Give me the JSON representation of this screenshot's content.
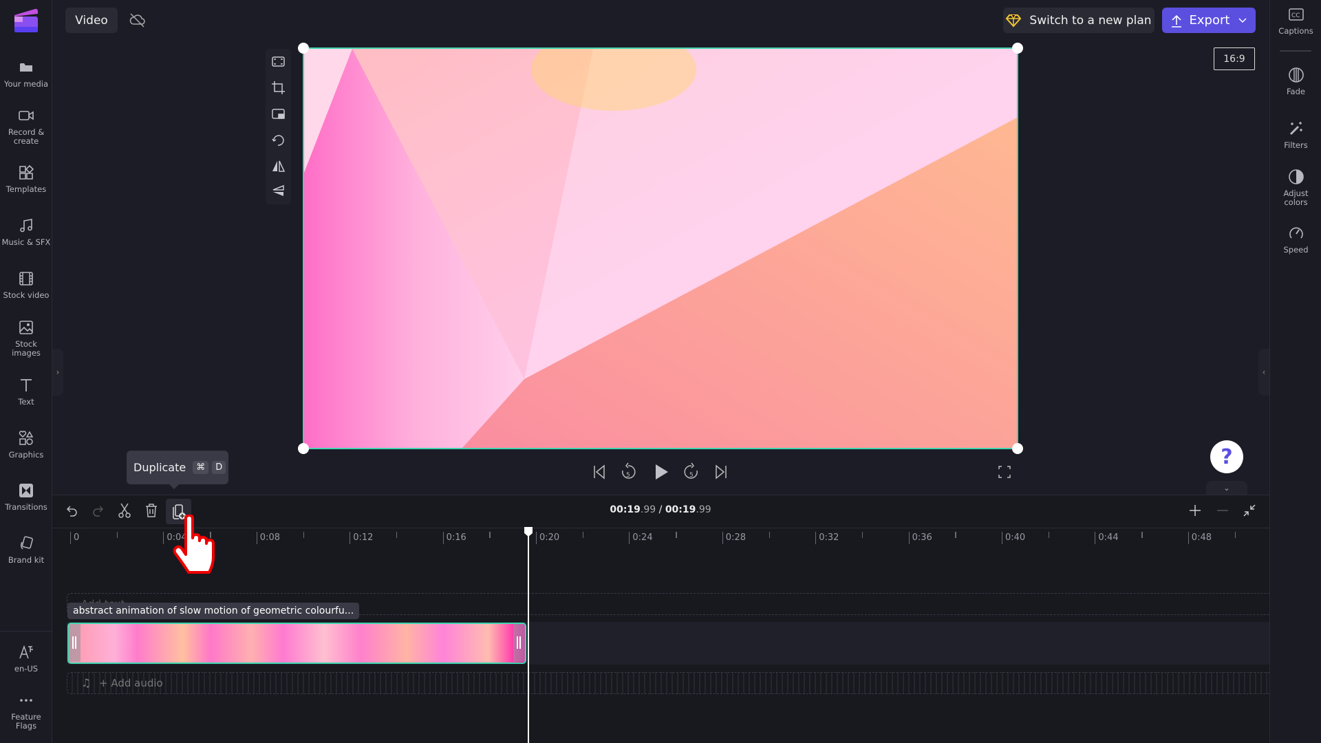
{
  "app": {
    "logo": "clipchamp-logo",
    "project_tab": "Video",
    "cloud_status_icon": "cloud-off-icon"
  },
  "header": {
    "plan_button": "Switch to a new plan",
    "export_button": "Export",
    "accent": "#5b4fe0"
  },
  "left_sidebar": {
    "items": [
      {
        "label": "Your media",
        "icon": "folder-icon"
      },
      {
        "label": "Record &\ncreate",
        "icon": "video-camera-icon"
      },
      {
        "label": "Templates",
        "icon": "templates-icon"
      },
      {
        "label": "Music & SFX",
        "icon": "music-note-icon"
      },
      {
        "label": "Stock video",
        "icon": "film-icon"
      },
      {
        "label": "Stock\nimages",
        "icon": "image-icon"
      },
      {
        "label": "Text",
        "icon": "text-icon"
      },
      {
        "label": "Graphics",
        "icon": "shapes-icon"
      },
      {
        "label": "Transitions",
        "icon": "transition-icon"
      },
      {
        "label": "Brand kit",
        "icon": "brand-kit-icon"
      }
    ],
    "bottom_items": [
      {
        "label": "en-US",
        "icon": "language-icon"
      },
      {
        "label": "Feature\nFlags",
        "icon": "more-icon"
      }
    ]
  },
  "right_sidebar": {
    "items": [
      {
        "label": "Captions",
        "icon": "captions-icon"
      },
      {
        "label": "Fade",
        "icon": "fade-icon"
      },
      {
        "label": "Filters",
        "icon": "magic-wand-icon"
      },
      {
        "label": "Adjust\ncolors",
        "icon": "contrast-icon"
      },
      {
        "label": "Speed",
        "icon": "speedometer-icon"
      }
    ]
  },
  "preview": {
    "aspect_ratio": "16:9",
    "selection_color": "#3fd6b0"
  },
  "tooltip": {
    "label": "Duplicate",
    "key1": "⌘",
    "key2": "D"
  },
  "timeline": {
    "current_time_main": "00:19",
    "current_time_frac": ".99",
    "separator": "/",
    "total_time_main": "00:19",
    "total_time_frac": ".99",
    "ruler": [
      "0",
      "0:04",
      "0:08",
      "0:12",
      "0:16",
      "0:20",
      "0:24",
      "0:28",
      "0:32",
      "0:36",
      "0:40",
      "0:44",
      "0:48"
    ],
    "playhead_seconds": 19.99,
    "clip_label": "abstract animation of slow motion of geometric colourfu...",
    "add_text": "Add text",
    "add_audio": "+ Add audio"
  }
}
